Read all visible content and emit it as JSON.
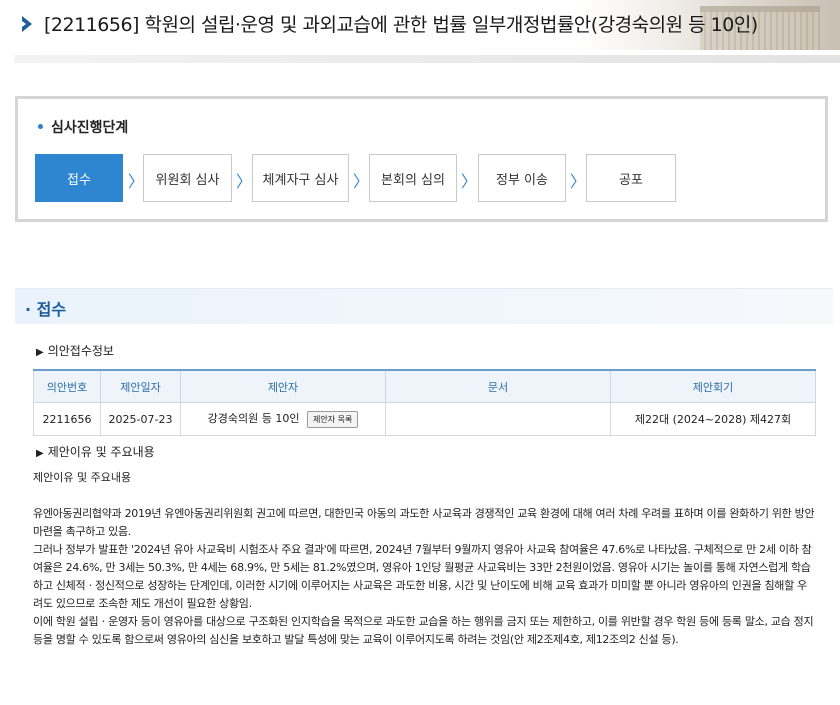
{
  "header": {
    "title": "[2211656] 학원의 설립·운영 및 과외교습에 관한 법률 일부개정법률안(강경숙의원 등 10인)"
  },
  "stage": {
    "title": "심사진행단계",
    "steps": [
      {
        "label": "접수",
        "active": true
      },
      {
        "label": "위원회 심사",
        "active": false
      },
      {
        "label": "체계자구 심사",
        "active": false
      },
      {
        "label": "본회의 심의",
        "active": false
      },
      {
        "label": "정부 이송",
        "active": false
      },
      {
        "label": "공포",
        "active": false
      }
    ]
  },
  "section": {
    "title": "접수",
    "bill_info_label": "의안접수정보",
    "table": {
      "headers": [
        "의안번호",
        "제안일자",
        "제안자",
        "문서",
        "제안회기"
      ],
      "row": {
        "bill_no": "2211656",
        "date": "2025-07-23",
        "proposer": "강경숙의원 등 10인",
        "proposer_button": "제안자 목록",
        "document": "",
        "session": "제22대 (2024~2028) 제427회"
      }
    },
    "reason_label": "제안이유 및 주요내용",
    "reason_heading": "제안이유 및 주요내용",
    "paragraphs": [
      "유엔아동권리협약과 2019년 유엔아동권리위원회 권고에 따르면, 대한민국 아동의 과도한 사교육과 경쟁적인 교육 환경에 대해 여러 차례 우려를 표하며 이를 완화하기 위한 방안 마련을 촉구하고 있음.",
      "그러나 정부가 발표한 '2024년 유아 사교육비 시험조사 주요 결과'에 따르면, 2024년 7월부터 9월까지 영유아 사교육 참여율은 47.6%로 나타났음. 구체적으로 만 2세 이하 참여율은 24.6%, 만 3세는 50.3%, 만 4세는 68.9%, 만 5세는 81.2%였으며, 영유아 1인당 월평균 사교육비는 33만 2천원이었음. 영유아 시기는 놀이를 통해 자연스럽게 학습하고 신체적ㆍ정신적으로 성장하는 단계인데, 이러한 시기에 이루어지는 사교육은 과도한 비용, 시간 및 난이도에 비해 교육 효과가 미미할 뿐 아니라 영유아의 인권을 침해할 우려도 있으므로 조속한 제도 개선이 필요한 상황임.",
      "이에 학원 설립ㆍ운영자 등이 영유아를 대상으로 구조화된 인지학습을 목적으로 과도한 교습을 하는 행위를 금지 또는 제한하고, 이를 위반할 경우 학원 등에 등록 말소, 교습 정지 등을 명할 수 있도록 함으로써 영유아의 심신을 보호하고 발달 특성에 맞는 교육이 이루어지도록 하려는 것임(안 제2조제4호, 제12조의2 신설 등)."
    ]
  }
}
